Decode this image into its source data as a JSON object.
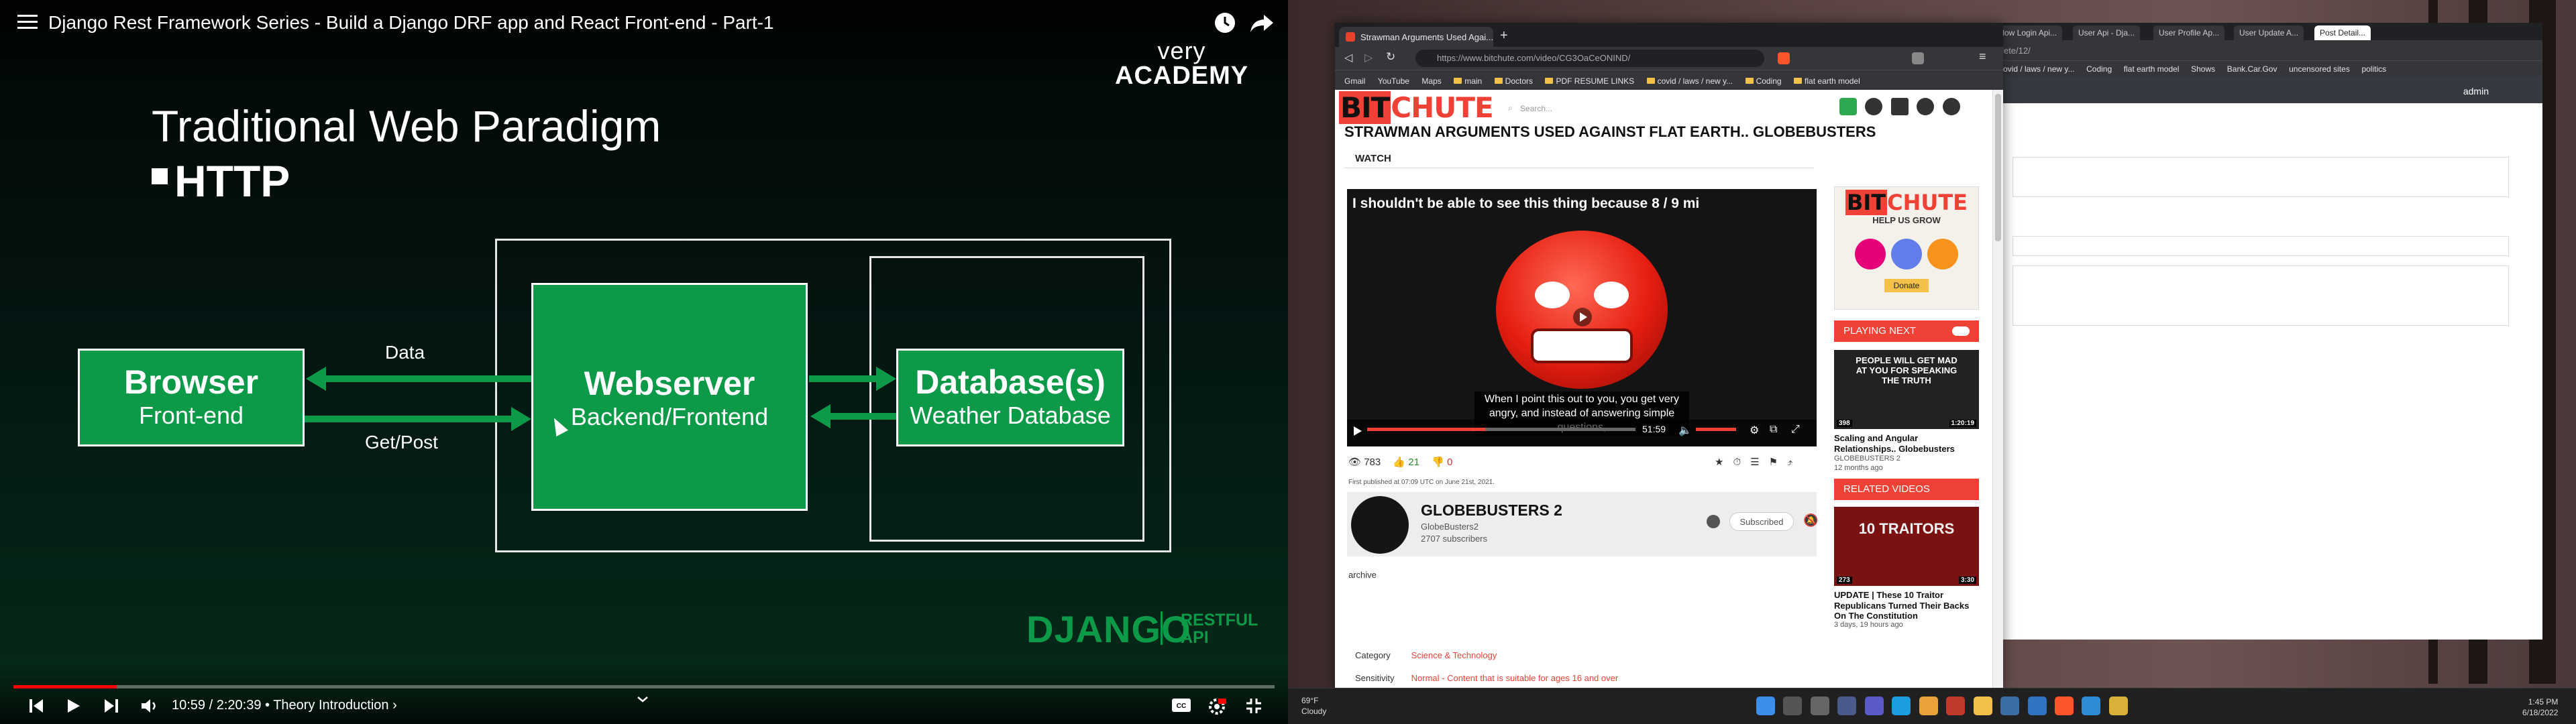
{
  "youtube": {
    "video_title": "Django Rest Framework Series - Build a Django DRF app and React Front-end - Part-1",
    "brand_line1": "very",
    "brand_line2": "ACADEMY",
    "progress_fraction": 0.082,
    "time_display": "10:59 / 2:20:39 • Theory Introduction ›",
    "slide": {
      "heading": "Traditional Web Paradigm",
      "subheading": "HTTP",
      "browser_title": "Browser",
      "browser_sub": "Front-end",
      "webserver_title": "Webserver",
      "webserver_sub": "Backend/Frontend",
      "db_title": "Database(s)",
      "db_sub": "Weather Database",
      "arrow_top_label": "Data",
      "arrow_bottom_label": "Get/Post",
      "footer_logo": "DJANGO",
      "footer_sub1": "RESTFUL",
      "footer_sub2": "API"
    },
    "colors": {
      "slide_green": "#0d9a48",
      "progress_red": "#ff0000"
    }
  },
  "browser_front": {
    "tab_title": "Strawman Arguments Used Agai...",
    "url": "https://www.bitchute.com/video/CG3OaCeONIND/",
    "bookmarks": [
      "Gmail",
      "YouTube",
      "Maps",
      "main",
      "Doctors",
      "PDF RESUME LINKS",
      "covid / laws / new y...",
      "Coding",
      "flat earth model"
    ],
    "site": {
      "logo_bit": "BIT",
      "logo_chute": "CHUTE",
      "search_placeholder": "Search...",
      "video_title": "STRAWMAN ARGUMENTS USED AGAINST FLAT EARTH.. GLOBEBUSTERS",
      "watch_tab": "WATCH",
      "player_top_text": "I shouldn't be able to see this thing because 8 / 9 mi",
      "subtitle": "When I point this out to you, you get very angry, and instead of answering simple questions,",
      "player_time": "51:59",
      "views": "783",
      "likes": "21",
      "dislikes": "0",
      "published": "First published at 07:09 UTC on June 21st, 2021.",
      "channel_name": "GLOBEBUSTERS 2",
      "channel_handle": "GlobeBusters2",
      "subscribers": "2707 subscribers",
      "subscribe_btn": "Subscribed",
      "archive": "archive",
      "category_label": "Category",
      "category_value": "Science & Technology",
      "sensitivity_label": "Sensitivity",
      "sensitivity_value": "Normal - Content that is suitable for ages 16 and over",
      "side_help": "HELP US GROW",
      "side_donate": "Donate",
      "playing_next": "PLAYING NEXT",
      "next_thumb_text": "PEOPLE WILL GET MAD AT YOU FOR SPEAKING THE TRUTH",
      "next_title": "Scaling and Angular Relationships.. Globebusters",
      "next_channel": "GLOBEBUSTERS 2",
      "next_age": "12 months ago",
      "next_views": "398",
      "next_duration": "1:20:19",
      "related_videos": "RELATED VIDEOS",
      "rel_thumb_text": "10 TRAITORS",
      "rel_title": "UPDATE | These 10 Traitor Republicans Turned Their Backs On The Constitution",
      "rel_age": "3 days, 19 hours ago",
      "rel_views": "273",
      "rel_duration": "3:30"
    }
  },
  "browser_back": {
    "tabs": [
      "Flow Login Api...",
      "User Api - Dja...",
      "User Profile Ap...",
      "User Update A...",
      "Post Detail..."
    ],
    "url_fragment": "/delete/12/",
    "bookmarks": [
      "covid / laws / new y...",
      "Coding",
      "flat earth model",
      "Shows",
      "Bank.Car.Gov",
      "uncensored sites",
      "politics"
    ],
    "header_user": "admin"
  },
  "taskbar": {
    "weather_temp": "69°F",
    "weather_desc": "Cloudy",
    "time": "1:45 PM",
    "date": "6/18/2022"
  }
}
